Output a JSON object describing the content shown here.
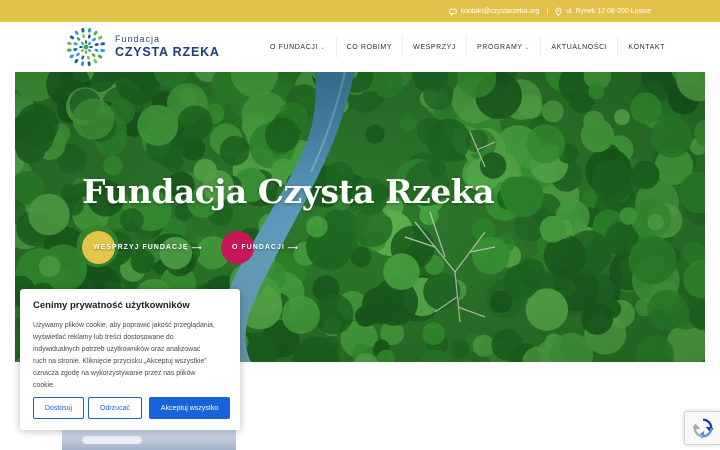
{
  "topbar": {
    "email": "kontakt@czystarzeka.org",
    "separator": "|",
    "address": "ul. Rynek 12 08-200 Łosice",
    "background": "#e2c148"
  },
  "header": {
    "logo_small": "Fundacja",
    "logo_big": "CZYSTA RZEKA",
    "nav": [
      {
        "label": "O FUNDACJI",
        "has_dropdown": true
      },
      {
        "label": "CO ROBIMY",
        "has_dropdown": false
      },
      {
        "label": "WESPRZYJ",
        "has_dropdown": false
      },
      {
        "label": "PROGRAMY",
        "has_dropdown": true
      },
      {
        "label": "AKTUALNOŚCI",
        "has_dropdown": false
      },
      {
        "label": "KONTAKT",
        "has_dropdown": false
      }
    ],
    "dropdown_caret": "⌄"
  },
  "hero": {
    "title": "Fundacja Czysta Rzeka",
    "buttons": [
      {
        "label": "WESPRZYJ FUNDACJĘ",
        "arrow": "⟶",
        "accent": "#e4c549"
      },
      {
        "label": "O FUNDACJI",
        "arrow": "⟶",
        "accent": "#c8165a"
      }
    ]
  },
  "cookie": {
    "title": "Cenimy prywatność użytkowników",
    "text_lines": [
      "Używamy plików cookie, aby poprawić jakość przeglądania,",
      "wyświetlać reklamy lub treści dostosowane do",
      "indywidualnych potrzeb użytkowników oraz analizować",
      "ruch na stronie. Kliknięcie przycisku „Akceptuj wszystkie\"",
      "oznacza zgodę na wykorzystywanie przez nas plików",
      "cookie."
    ],
    "customize_label": "Dostosuj",
    "reject_label": "Odrzucać",
    "accept_label": "Akceptuj wszystko",
    "accent": "#1863dc"
  },
  "icons": {
    "email": "chat-bubble-icon",
    "address": "map-pin-icon",
    "recaptcha": "recaptcha-icon"
  }
}
